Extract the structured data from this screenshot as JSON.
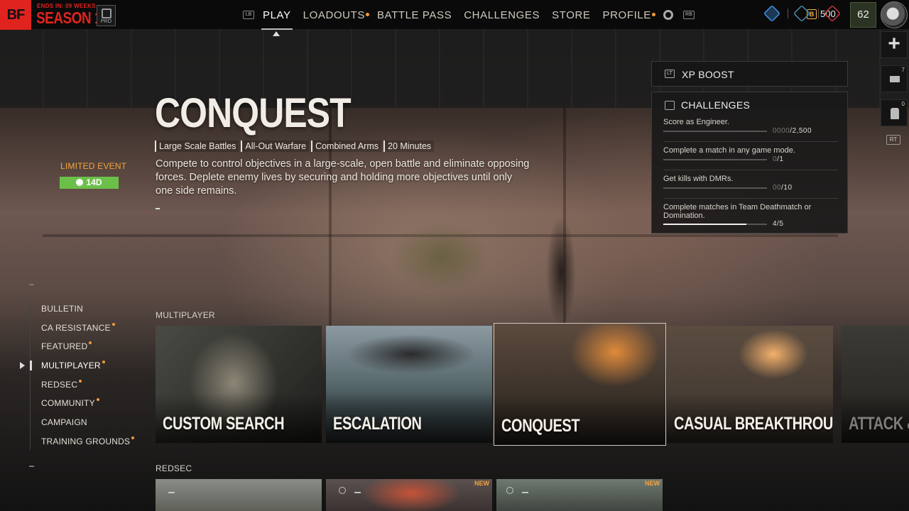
{
  "top_bar": {
    "logo": "BF",
    "season_ends": "ENDS IN: 09 WEEKS",
    "season_name": "SEASON 1",
    "pro_label": "PRO",
    "lb_hint": "LB",
    "rb_hint": "RB",
    "nav": [
      {
        "label": "PLAY",
        "active": true,
        "dot": false
      },
      {
        "label": "LOADOUTS",
        "active": false,
        "dot": true
      },
      {
        "label": "BATTLE PASS",
        "active": false,
        "dot": false
      },
      {
        "label": "CHALLENGES",
        "active": false,
        "dot": false
      },
      {
        "label": "STORE",
        "active": false,
        "dot": false
      },
      {
        "label": "PROFILE",
        "active": false,
        "dot": true
      }
    ],
    "currency_icon": "B",
    "currency": "500",
    "level": "62"
  },
  "right_rail": {
    "mail_count": "7",
    "friends_count": "0",
    "rt_hint": "RT"
  },
  "hero": {
    "title": "CONQUEST",
    "tags": [
      "Large Scale Battles",
      "All-Out Warfare",
      "Combined Arms",
      "20 Minutes"
    ],
    "description": "Compete to control objectives in a large-scale, open battle and eliminate opposing forces. Deplete enemy lives by securing and holding more objectives until only one side remains.",
    "limited_event": "LIMITED EVENT",
    "timer": "14D"
  },
  "xp_boost": {
    "lt_hint": "LT",
    "label": "XP BOOST"
  },
  "challenges": {
    "title": "CHALLENGES",
    "items": [
      {
        "text": "Score as Engineer.",
        "progress_dim": "0000",
        "progress": "/2,500",
        "fraction": 0.0
      },
      {
        "text": "Complete a match in any game mode.",
        "progress_dim": "0",
        "progress": "/1",
        "fraction": 0.0
      },
      {
        "text": "Get kills with DMRs.",
        "progress_dim": "00",
        "progress": "/10",
        "fraction": 0.0
      },
      {
        "text": "Complete matches in Team Deathmatch or Domination.",
        "progress_dim": "",
        "progress": "4/5",
        "fraction": 0.8
      }
    ]
  },
  "left_menu": {
    "items": [
      {
        "label": "BULLETIN",
        "dot": false
      },
      {
        "label": "CA RESISTANCE",
        "dot": true
      },
      {
        "label": "FEATURED",
        "dot": true
      },
      {
        "label": "MULTIPLAYER",
        "dot": true,
        "selected": true
      },
      {
        "label": "REDSEC",
        "dot": true
      },
      {
        "label": "COMMUNITY",
        "dot": true
      },
      {
        "label": "CAMPAIGN",
        "dot": false
      },
      {
        "label": "TRAINING GROUNDS",
        "dot": true
      }
    ]
  },
  "multiplayer": {
    "label": "MULTIPLAYER",
    "cards": [
      "CUSTOM SEARCH",
      "ESCALATION",
      "CONQUEST",
      "CASUAL BREAKTHROUGH",
      "ATTACK & D"
    ]
  },
  "redsec": {
    "label": "REDSEC",
    "cards": [
      {
        "new": ""
      },
      {
        "new": "NEW"
      },
      {
        "new": "NEW"
      }
    ]
  }
}
